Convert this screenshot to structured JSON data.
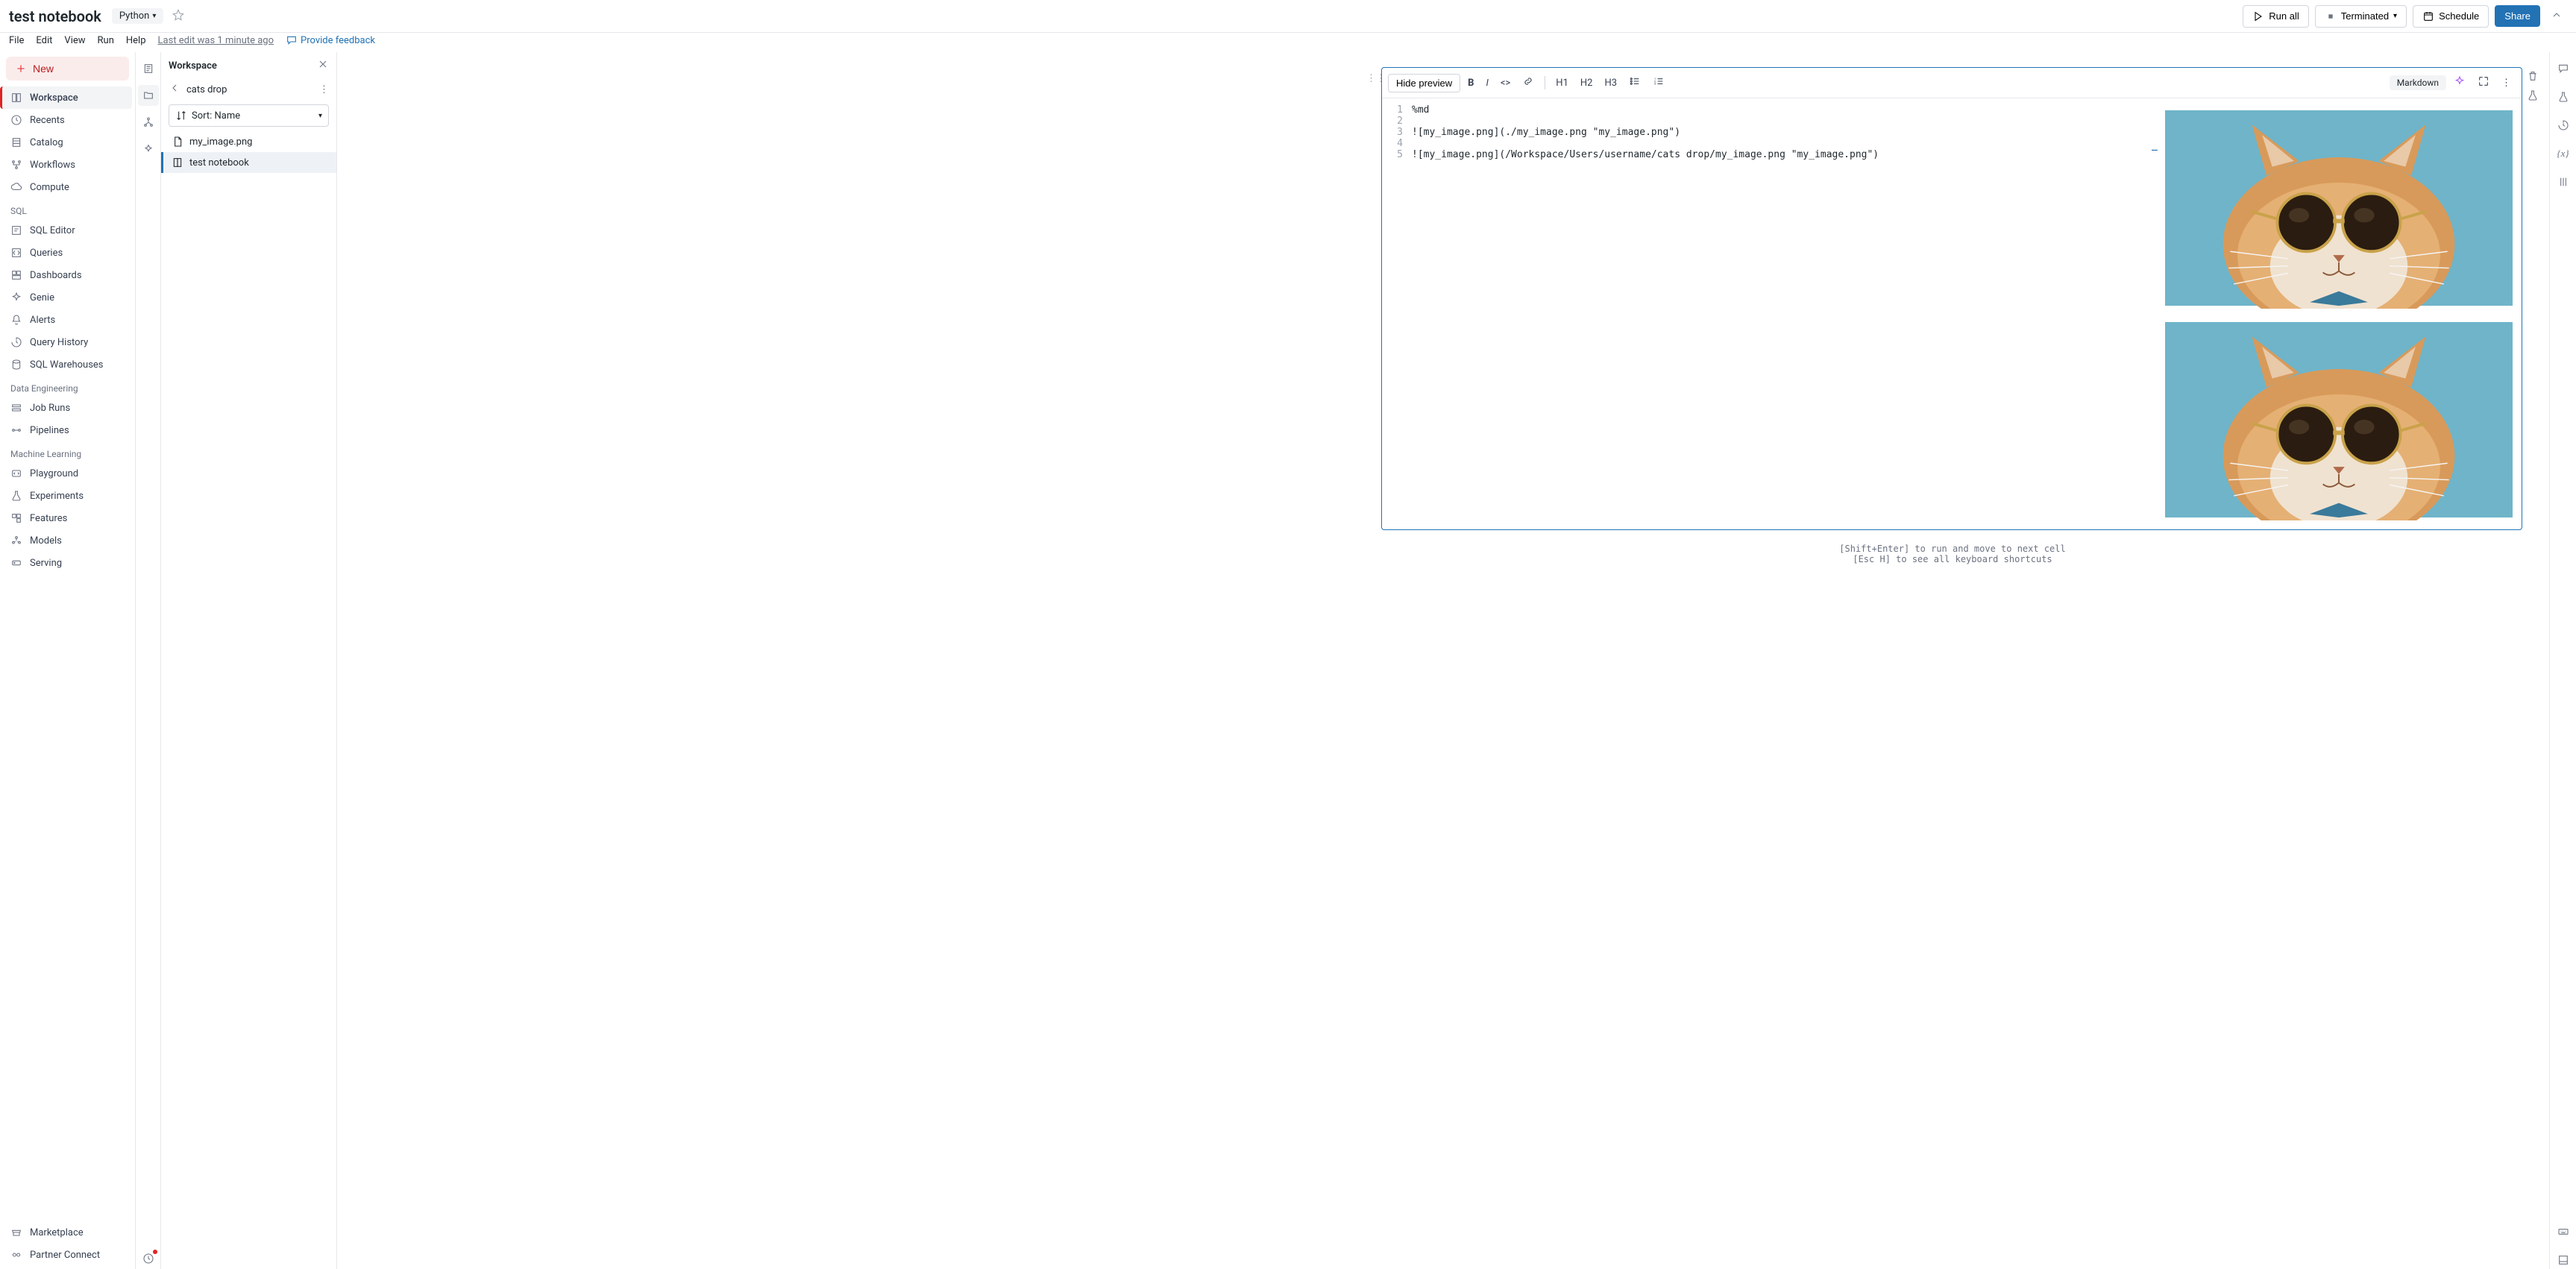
{
  "header": {
    "title": "test notebook",
    "language": "Python",
    "run_all": "Run all",
    "status": "Terminated",
    "schedule": "Schedule",
    "share": "Share"
  },
  "menu": {
    "items": [
      "File",
      "Edit",
      "View",
      "Run",
      "Help"
    ],
    "last_edit": "Last edit was 1 minute ago",
    "feedback": "Provide feedback"
  },
  "sidebar": {
    "new_label": "New",
    "main": [
      {
        "label": "Workspace",
        "icon": "workspace"
      },
      {
        "label": "Recents",
        "icon": "clock"
      },
      {
        "label": "Catalog",
        "icon": "catalog"
      },
      {
        "label": "Workflows",
        "icon": "workflow"
      },
      {
        "label": "Compute",
        "icon": "cloud"
      }
    ],
    "sections": [
      {
        "title": "SQL",
        "items": [
          {
            "label": "SQL Editor",
            "icon": "sql"
          },
          {
            "label": "Queries",
            "icon": "query"
          },
          {
            "label": "Dashboards",
            "icon": "dash"
          },
          {
            "label": "Genie",
            "icon": "genie"
          },
          {
            "label": "Alerts",
            "icon": "bell"
          },
          {
            "label": "Query History",
            "icon": "history"
          },
          {
            "label": "SQL Warehouses",
            "icon": "warehouse"
          }
        ]
      },
      {
        "title": "Data Engineering",
        "items": [
          {
            "label": "Job Runs",
            "icon": "jobs"
          },
          {
            "label": "Pipelines",
            "icon": "pipe"
          }
        ]
      },
      {
        "title": "Machine Learning",
        "items": [
          {
            "label": "Playground",
            "icon": "play"
          },
          {
            "label": "Experiments",
            "icon": "flask"
          },
          {
            "label": "Features",
            "icon": "feat"
          },
          {
            "label": "Models",
            "icon": "model"
          },
          {
            "label": "Serving",
            "icon": "serve"
          }
        ]
      }
    ],
    "bottom": [
      {
        "label": "Marketplace",
        "icon": "market"
      },
      {
        "label": "Partner Connect",
        "icon": "partner"
      }
    ]
  },
  "filebrowser": {
    "title": "Workspace",
    "folder": "cats drop",
    "sort_label": "Sort: Name",
    "items": [
      {
        "label": "my_image.png",
        "icon": "file"
      },
      {
        "label": "test notebook",
        "icon": "notebook",
        "selected": true
      }
    ]
  },
  "cell": {
    "hide_preview": "Hide preview",
    "headings": [
      "H1",
      "H2",
      "H3"
    ],
    "type_label": "Markdown",
    "lines": [
      "%md",
      "",
      "![my_image.png](./my_image.png \"my_image.png\")",
      "",
      "![my_image.png](/Workspace/Users/username/cats drop/my_image.png \"my_image.png\")"
    ]
  },
  "hints": {
    "line1": "[Shift+Enter] to run and move to next cell",
    "line2": "[Esc H] to see all keyboard shortcuts"
  }
}
